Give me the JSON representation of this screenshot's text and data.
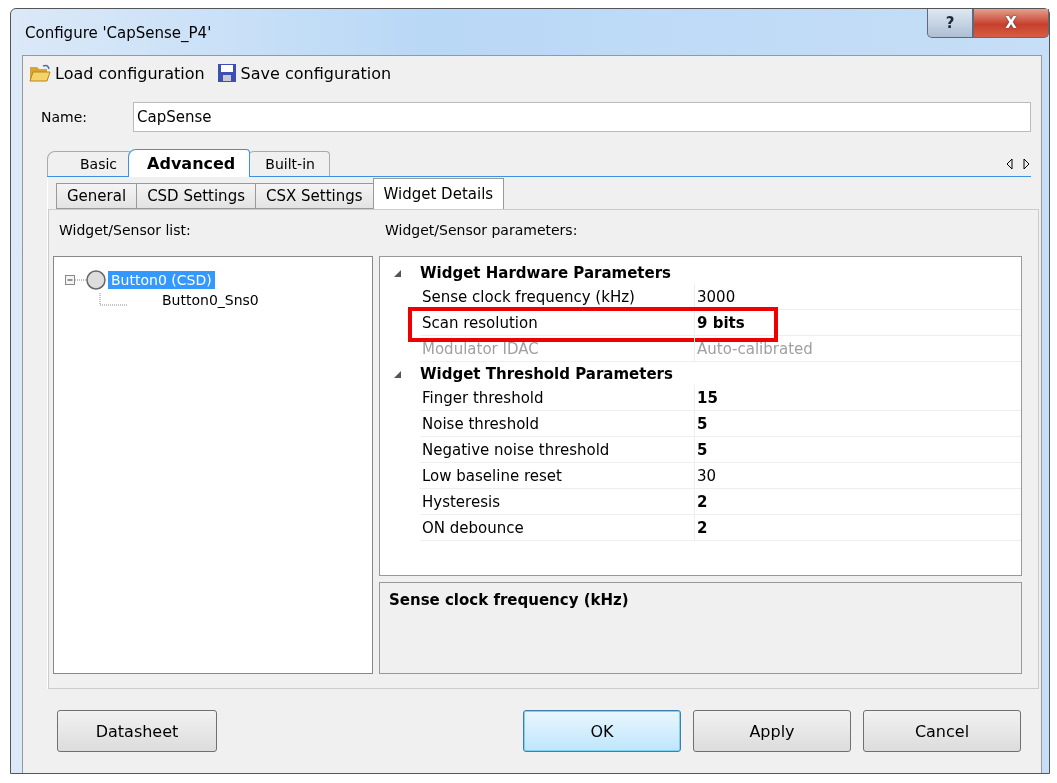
{
  "window": {
    "title": "Configure 'CapSense_P4'",
    "controls": [
      "?",
      "X"
    ]
  },
  "toolbar": [
    {
      "kind": "load",
      "label": "Load configuration"
    },
    {
      "kind": "save",
      "label": "Save configuration"
    }
  ],
  "name_field": {
    "label": "Name:",
    "value": "CapSense"
  },
  "tabs": [
    {
      "label": "Basic",
      "selected": false
    },
    {
      "label": "Advanced",
      "selected": true
    },
    {
      "label": "Built-in",
      "selected": false
    }
  ],
  "subtabs": [
    {
      "label": "General",
      "selected": false
    },
    {
      "label": "CSD Settings",
      "selected": false
    },
    {
      "label": "CSX Settings",
      "selected": false
    },
    {
      "label": "Widget Details",
      "selected": true
    }
  ],
  "sensor_list": {
    "heading": "Widget/Sensor list:",
    "tree": [
      {
        "label": "Button0 (CSD)",
        "selected": true,
        "expanded": true,
        "children": [
          {
            "label": "Button0_Sns0",
            "selected": false
          }
        ]
      }
    ]
  },
  "parameters": {
    "heading": "Widget/Sensor parameters:",
    "groups": [
      {
        "title": "Widget Hardware Parameters",
        "expanded": true,
        "rows": [
          {
            "name": "Sense clock frequency (kHz)",
            "value": "3000",
            "bold": false,
            "disabled": false,
            "highlighted": false
          },
          {
            "name": "Scan resolution",
            "value": "9 bits",
            "bold": true,
            "disabled": false,
            "highlighted": true
          },
          {
            "name": "Modulator IDAC",
            "value": "Auto-calibrated",
            "bold": false,
            "disabled": true,
            "highlighted": false
          }
        ]
      },
      {
        "title": "Widget Threshold Parameters",
        "expanded": true,
        "rows": [
          {
            "name": "Finger threshold",
            "value": "15",
            "bold": true,
            "disabled": false,
            "highlighted": false
          },
          {
            "name": "Noise threshold",
            "value": "5",
            "bold": true,
            "disabled": false,
            "highlighted": false
          },
          {
            "name": "Negative noise threshold",
            "value": "5",
            "bold": true,
            "disabled": false,
            "highlighted": false
          },
          {
            "name": "Low baseline reset",
            "value": "30",
            "bold": false,
            "disabled": false,
            "highlighted": false
          },
          {
            "name": "Hysteresis",
            "value": "2",
            "bold": true,
            "disabled": false,
            "highlighted": false
          },
          {
            "name": "ON debounce",
            "value": "2",
            "bold": true,
            "disabled": false,
            "highlighted": false
          }
        ]
      }
    ],
    "description": "Sense clock frequency (kHz)"
  },
  "buttons": {
    "left": [
      "Datasheet"
    ],
    "right": [
      {
        "label": "OK",
        "default": true
      },
      {
        "label": "Apply",
        "default": false
      },
      {
        "label": "Cancel",
        "default": false
      }
    ]
  }
}
